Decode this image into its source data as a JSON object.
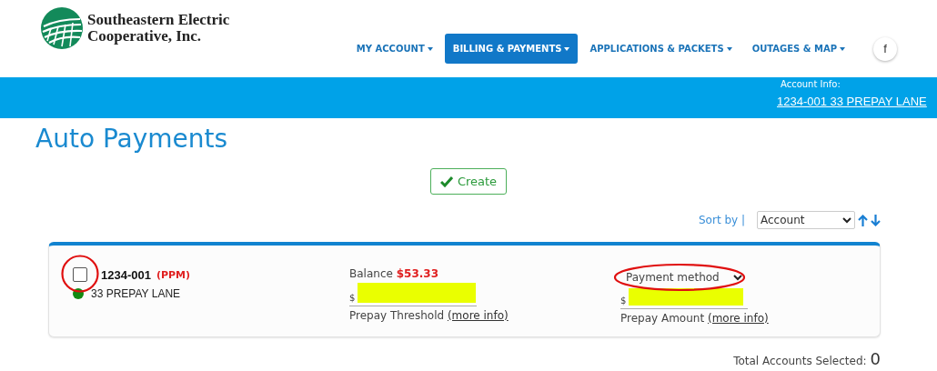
{
  "logo": {
    "line1": "Southeastern Electric",
    "line2": "Cooperative, Inc."
  },
  "nav": [
    {
      "label": "MY ACCOUNT",
      "selected": false
    },
    {
      "label": "BILLING & PAYMENTS",
      "selected": true
    },
    {
      "label": "APPLICATIONS & PACKETS",
      "selected": false
    },
    {
      "label": "OUTAGES & MAP",
      "selected": false
    }
  ],
  "social": {
    "glyph": "f"
  },
  "account_info": {
    "label": "Account Info:",
    "link": "1234-001  33 PREPAY LANE"
  },
  "page_title": "Auto Payments",
  "create_button": "Create",
  "sort": {
    "label": "Sort by |",
    "value": "Account"
  },
  "accounts": [
    {
      "checked": false,
      "number": "1234-001",
      "type": "(PPM)",
      "address": "33 PREPAY LANE",
      "color": "#138a13",
      "balance_label": "Balance",
      "balance": "$53.33",
      "threshold_prefix": "$",
      "threshold_label": "Prepay Threshold",
      "threshold_link": "(more info)",
      "method_placeholder": "Payment method",
      "amount_prefix": "$",
      "amount_label": "Prepay Amount",
      "amount_link": "(more info)"
    }
  ],
  "total_selected": {
    "label": "Total Accounts Selected:",
    "count": "0"
  }
}
